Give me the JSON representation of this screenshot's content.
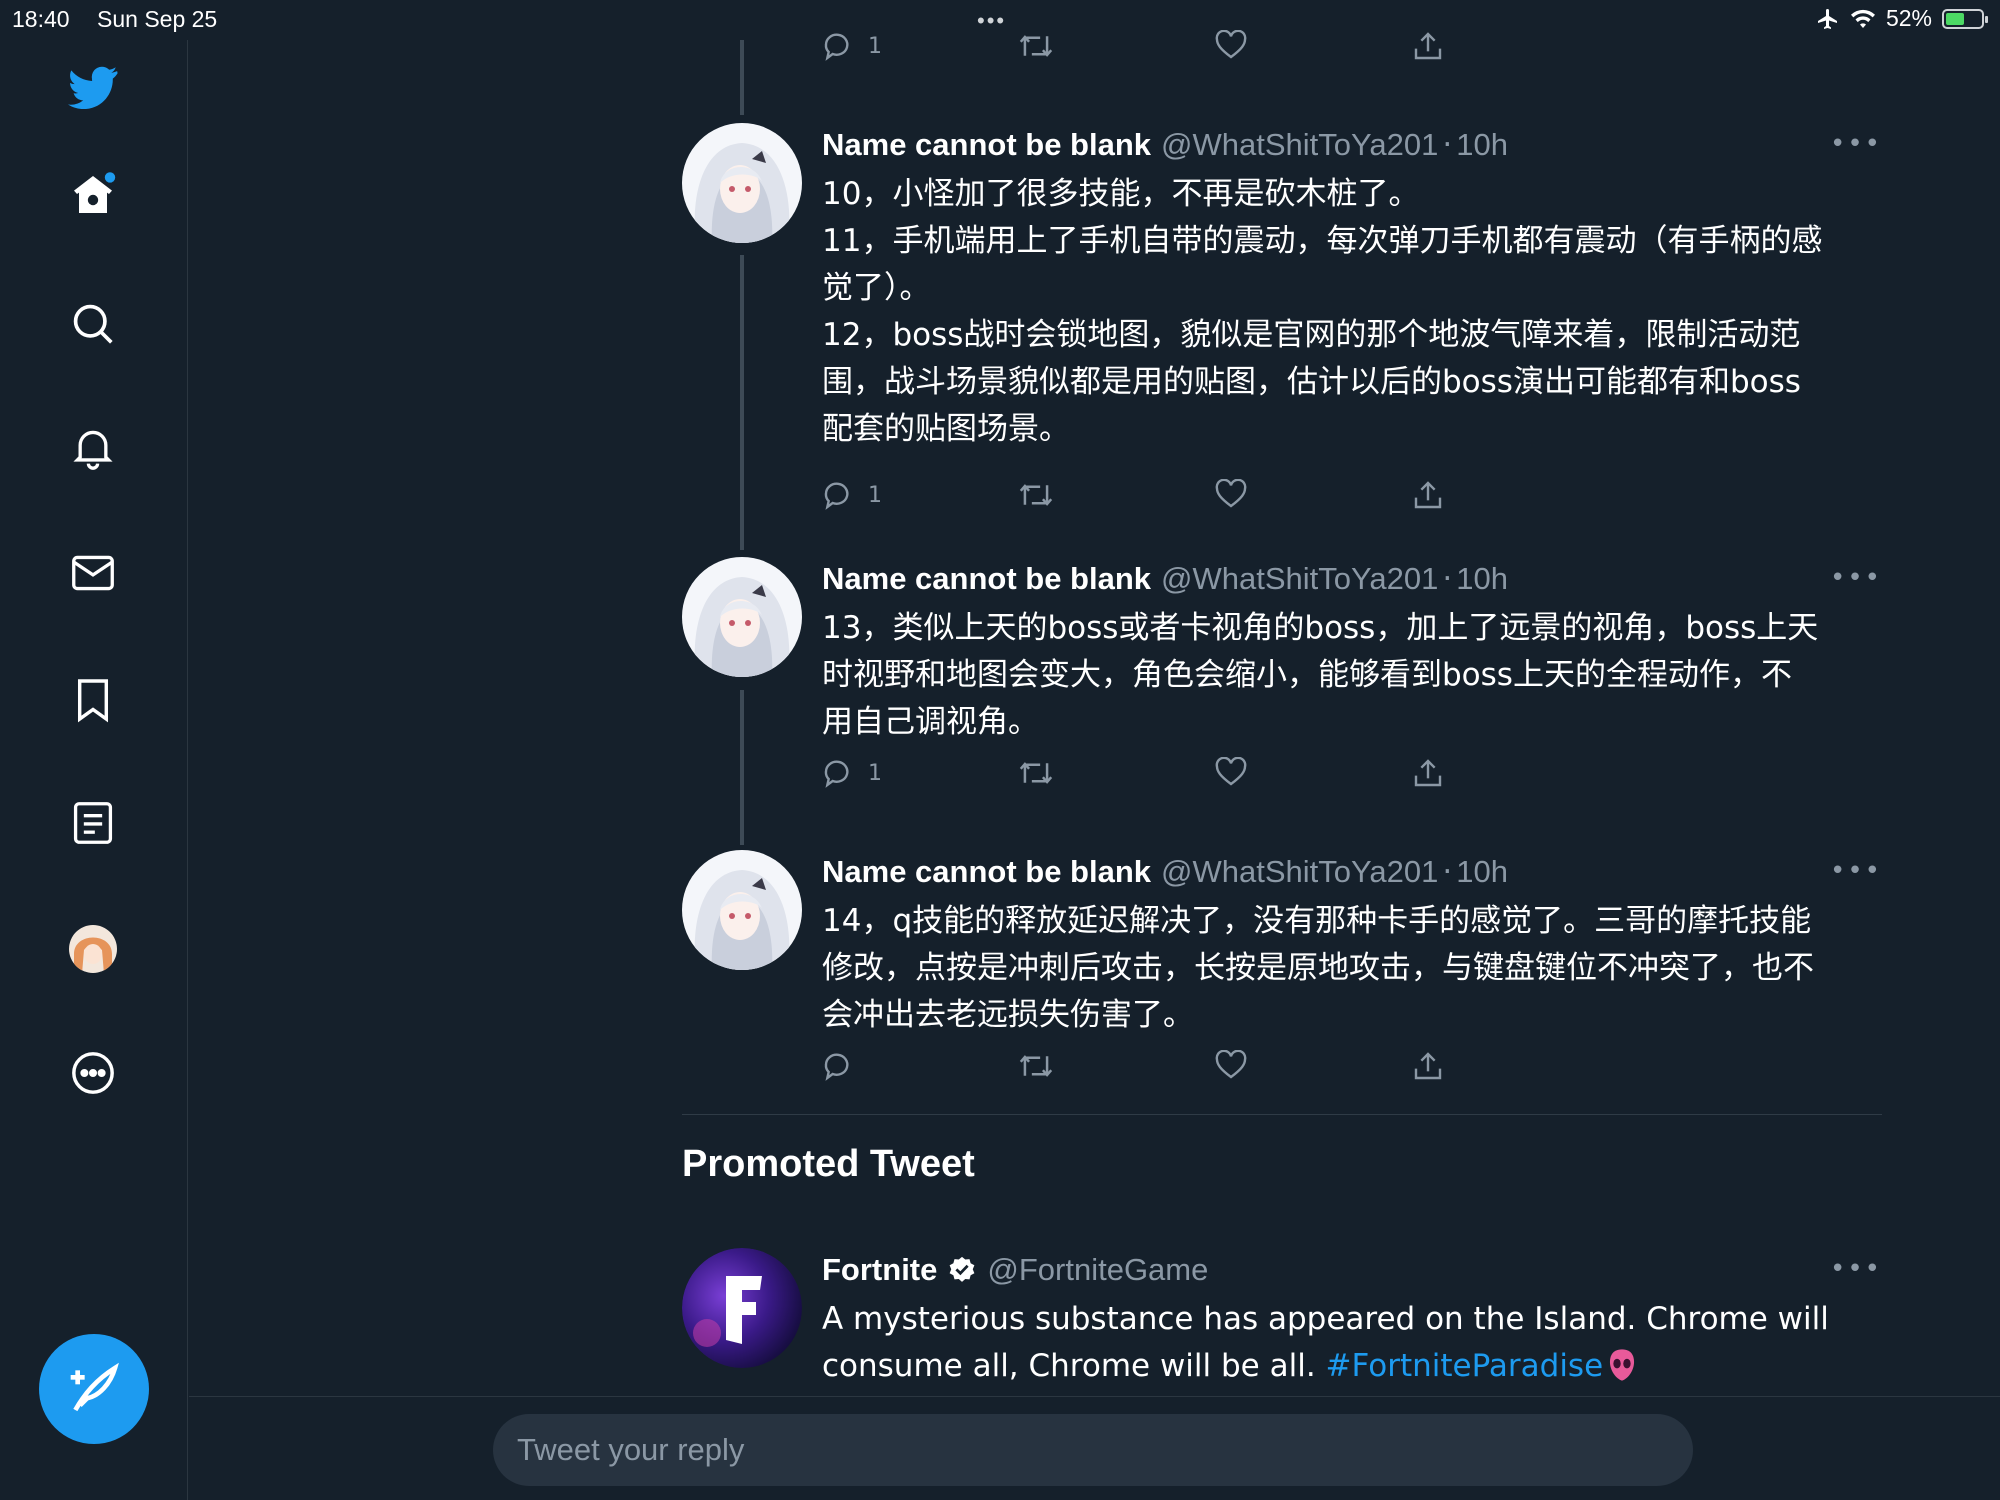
{
  "status_bar": {
    "time": "18:40",
    "date": "Sun Sep 25",
    "battery": "52%",
    "battery_level": 0.52
  },
  "sidebar": {
    "items": [
      {
        "name": "home",
        "icon": "home-icon"
      },
      {
        "name": "explore",
        "icon": "search-icon"
      },
      {
        "name": "notifications",
        "icon": "bell-icon"
      },
      {
        "name": "messages",
        "icon": "mail-icon"
      },
      {
        "name": "bookmarks",
        "icon": "bookmark-icon"
      },
      {
        "name": "lists",
        "icon": "list-icon"
      },
      {
        "name": "profile",
        "icon": "avatar"
      },
      {
        "name": "more",
        "icon": "more-circle-icon"
      }
    ],
    "compose_icon": "compose-icon"
  },
  "colors": {
    "background": "#15202b",
    "accent": "#1d9bf0",
    "muted": "#8b98a5"
  },
  "tweets": [
    {
      "author": "Name cannot be blank",
      "handle": "@WhatShitToYa201",
      "time": "10h",
      "text_lines": [
        "10，小怪加了很多技能，不再是砍木桩了。",
        "11，手机端用上了手机自带的震动，每次弹刀手机都有震动（有手柄的感",
        "觉了）。",
        "12，boss战时会锁地图，貌似是官网的那个地波气障来着，限制活动范",
        "围，战斗场景貌似都是用的贴图，估计以后的boss演出可能都有和boss",
        "配套的贴图场景。"
      ],
      "reply_count": "1"
    },
    {
      "author": "Name cannot be blank",
      "handle": "@WhatShitToYa201",
      "time": "10h",
      "text_lines": [
        "13，类似上天的boss或者卡视角的boss，加上了远景的视角，boss上天",
        "时视野和地图会变大，角色会缩小，能够看到boss上天的全程动作，不",
        "用自己调视角。"
      ],
      "reply_count": "1"
    },
    {
      "author": "Name cannot be blank",
      "handle": "@WhatShitToYa201",
      "time": "10h",
      "text_lines": [
        "14，q技能的释放延迟解决了，没有那种卡手的感觉了。三哥的摩托技能",
        "修改，点按是冲刺后攻击，长按是原地攻击，与键盘键位不冲突了，也不",
        "会冲出去老远损失伤害了。"
      ],
      "reply_count": ""
    }
  ],
  "top_tweet_reply_count": "1",
  "promoted": {
    "title": "Promoted Tweet",
    "author": "Fortnite",
    "handle": "@FortniteGame",
    "text_line1": "A mysterious substance has appeared on the Island. Chrome will",
    "text_line2_prefix": "consume all, Chrome will be all. ",
    "hashtag": "#FortniteParadise"
  },
  "reply": {
    "placeholder": "Tweet your reply"
  }
}
